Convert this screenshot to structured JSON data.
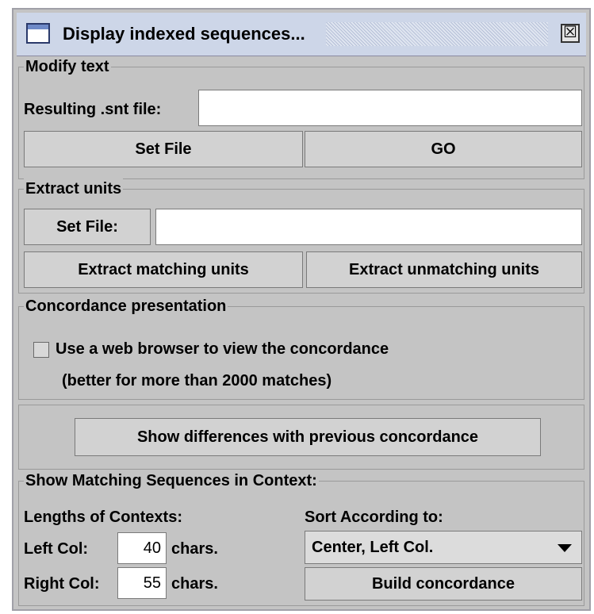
{
  "window": {
    "title": "Display indexed sequences...",
    "close_symbol": "☒"
  },
  "modify_text": {
    "group_title": "Modify text",
    "resulting_label": "Resulting .snt file:",
    "resulting_value": "",
    "set_file_label": "Set File",
    "go_label": "GO"
  },
  "extract_units": {
    "group_title": "Extract units",
    "set_file_label": "Set File:",
    "file_value": "",
    "matching_label": "Extract matching units",
    "unmatching_label": "Extract unmatching units"
  },
  "concordance_presentation": {
    "group_title": "Concordance presentation",
    "checkbox_label": "Use a web browser to view the concordance",
    "checkbox_checked": false,
    "note": "(better for more than 2000 matches)"
  },
  "differences_button_label": "Show differences with previous concordance",
  "context": {
    "group_title": "Show Matching Sequences in Context:",
    "lengths_label": "Lengths of Contexts:",
    "left_col_label": "Left Col:",
    "left_col_value": "40",
    "right_col_label": "Right Col:",
    "right_col_value": "55",
    "chars_label": "chars.",
    "sort_label": "Sort According to:",
    "sort_selected": "Center, Left Col.",
    "build_label": "Build concordance"
  }
}
